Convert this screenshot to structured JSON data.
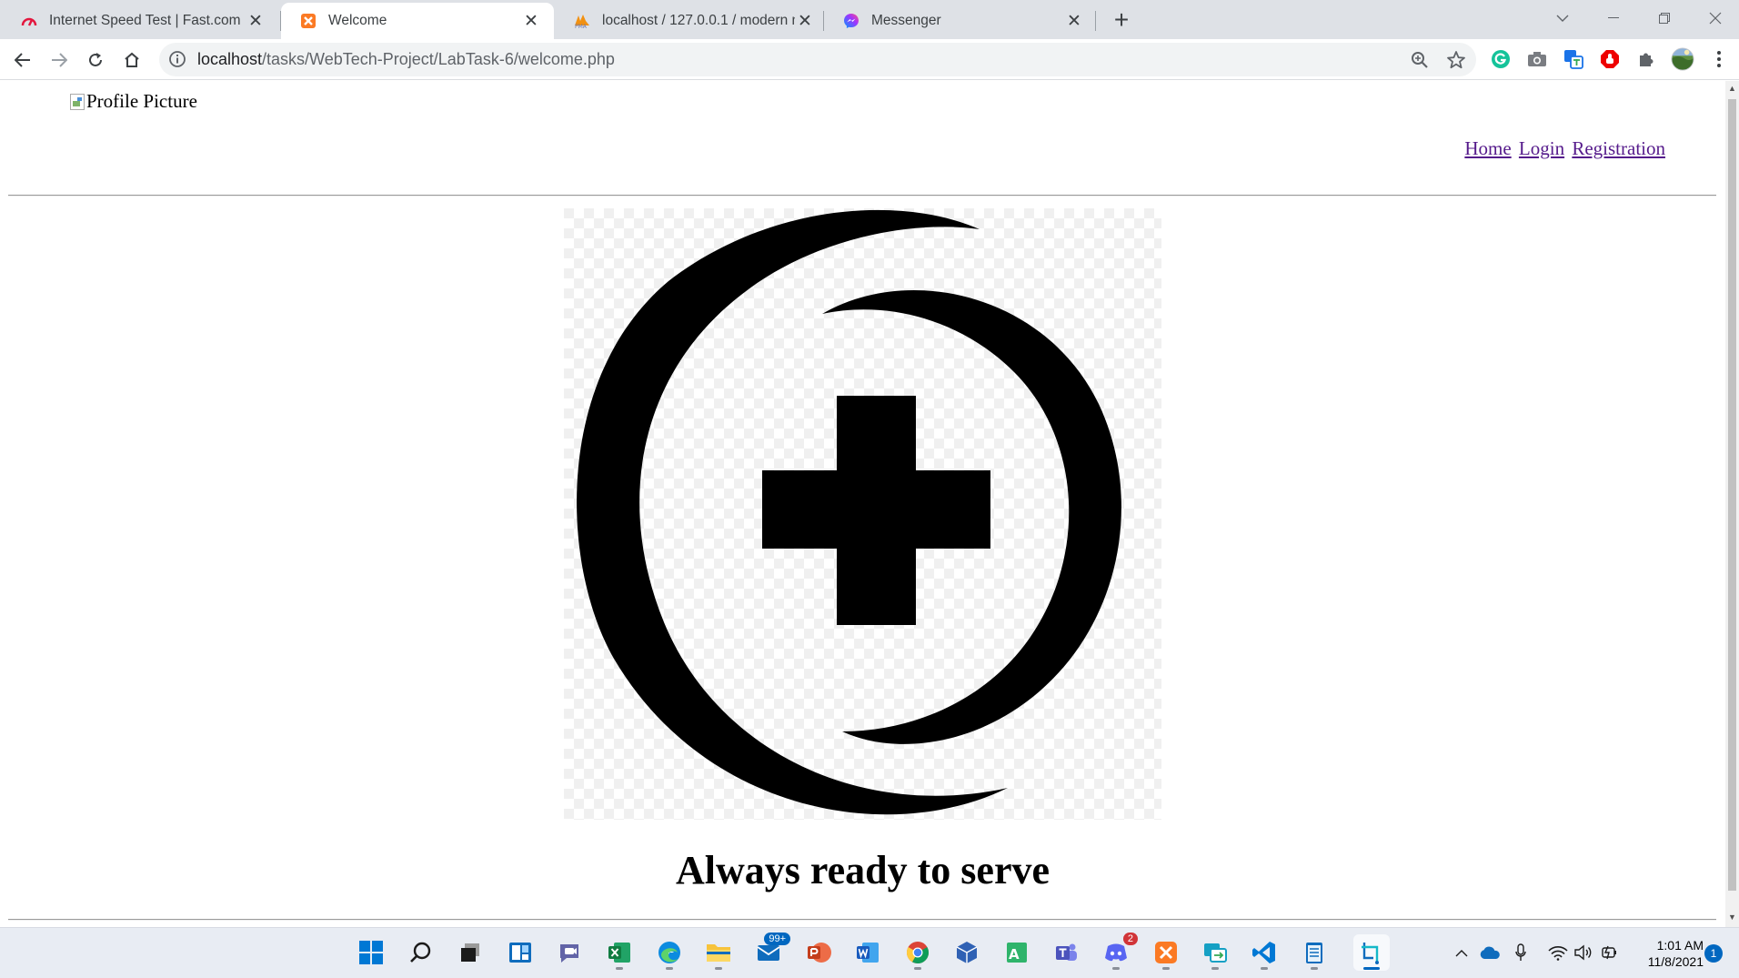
{
  "browser": {
    "tabs": [
      {
        "title": "Internet Speed Test | Fast.com",
        "favicon": "fast-icon",
        "active": false
      },
      {
        "title": "Welcome",
        "favicon": "xampp-icon",
        "active": true
      },
      {
        "title": "localhost / 127.0.0.1 / modern m",
        "favicon": "phpmyadmin-icon",
        "active": false
      },
      {
        "title": "Messenger",
        "favicon": "messenger-icon",
        "active": false
      }
    ],
    "address": {
      "host": "localhost",
      "path": "/tasks/WebTech-Project/LabTask-6/welcome.php"
    }
  },
  "page": {
    "profile_alt": "Profile Picture",
    "nav": {
      "home": "Home",
      "login": "Login",
      "registration": "Registration"
    },
    "tagline": "Always ready to serve",
    "colors": {
      "link": "#551a8b",
      "logo": "#000000"
    }
  },
  "taskbar": {
    "mail_badge": "99+",
    "discord_badge": "2",
    "time": "1:01 AM",
    "date": "11/8/2021",
    "notifications": "1"
  }
}
